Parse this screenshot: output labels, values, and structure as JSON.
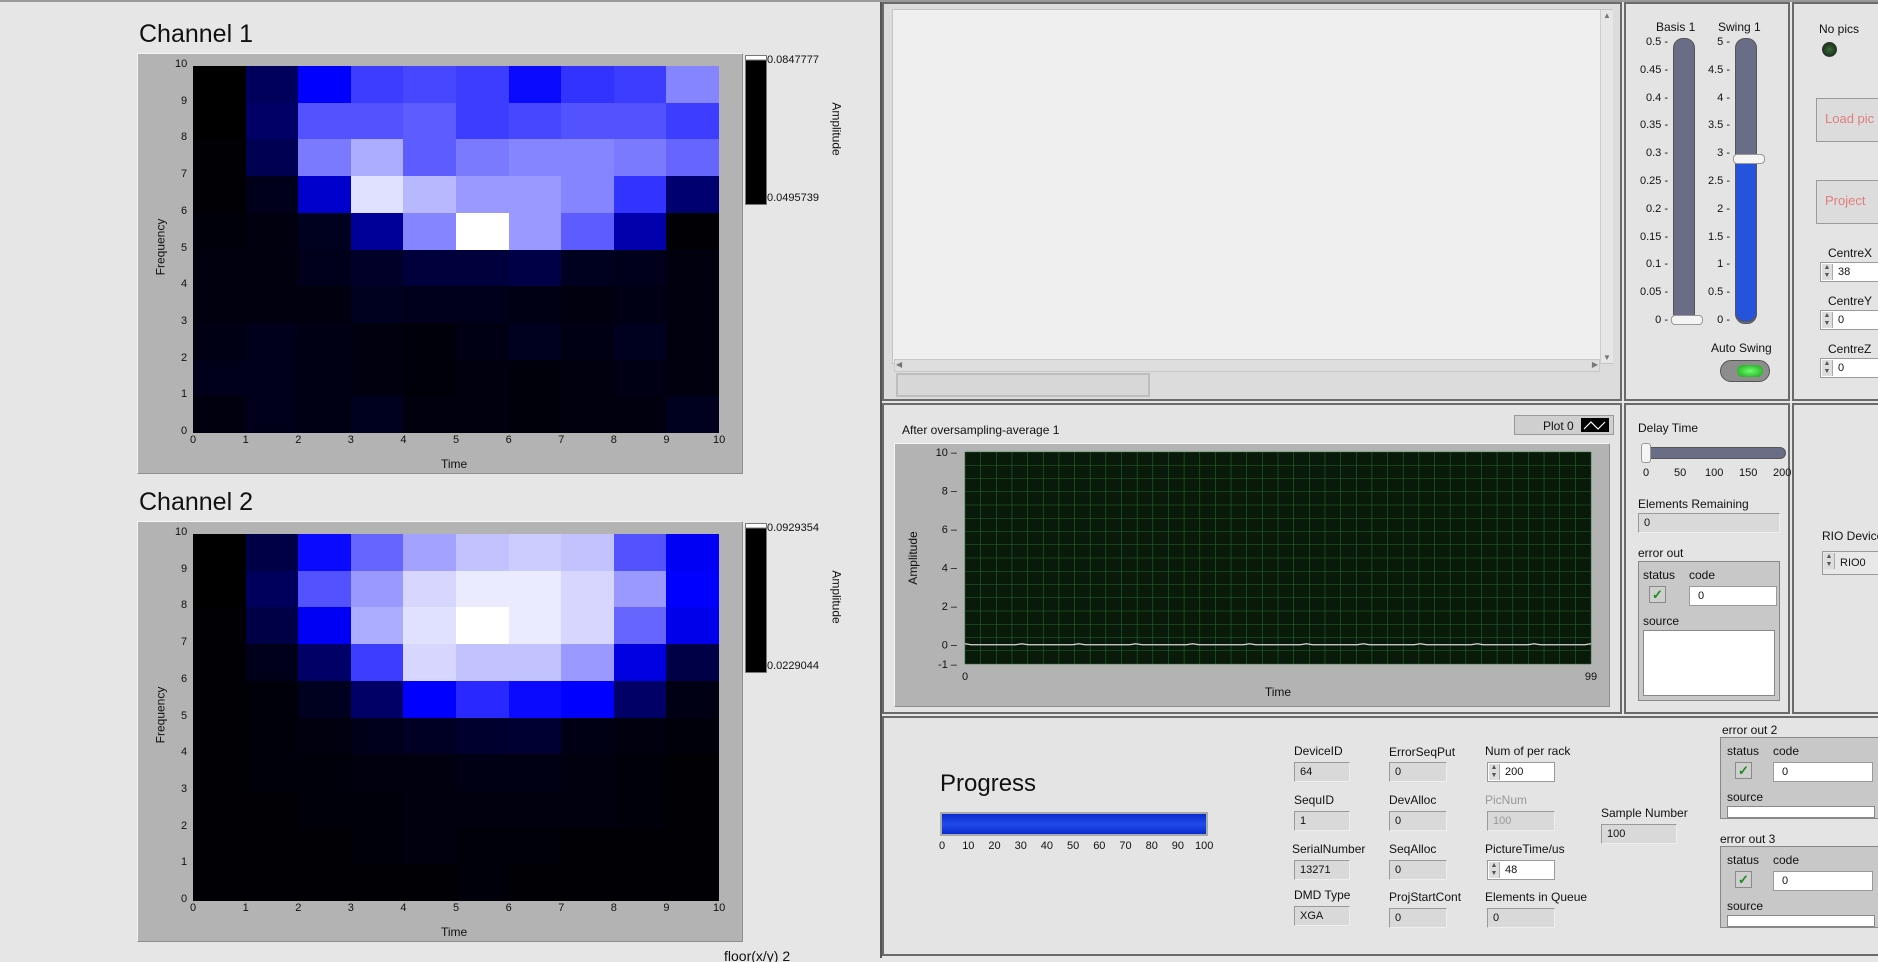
{
  "colors": {
    "accent": "#1a3cdc",
    "panel_bg": "#e6e6e6",
    "led_off": "#1c4a1c",
    "led_on": "#2fd12f",
    "plot_bg": "#0a1a0a",
    "plot_grid": "#1f6a2a",
    "ramp_top": "#ffffff",
    "ramp_bottom": "#000000"
  },
  "channel1": {
    "title": "Channel 1",
    "xlabel": "Time",
    "ylabel": "Frequency",
    "zlabel": "Amplitude",
    "zmax": "0.0847777",
    "zmin": "0.0495739",
    "ticks": [
      "0",
      "1",
      "2",
      "3",
      "4",
      "5",
      "6",
      "7",
      "8",
      "9",
      "10"
    ]
  },
  "channel2": {
    "title": "Channel 2",
    "xlabel": "Time",
    "ylabel": "Frequency",
    "zlabel": "Amplitude",
    "zmax": "0.0929354",
    "zmin": "0.0229044",
    "ticks": [
      "0",
      "1",
      "2",
      "3",
      "4",
      "5",
      "6",
      "7",
      "8",
      "9",
      "10"
    ]
  },
  "footer_text": "floor(x/y) 2",
  "chart_data": [
    {
      "type": "heatmap",
      "title": "Channel 1",
      "xlabel": "Time",
      "ylabel": "Frequency",
      "zlabel": "Amplitude",
      "xlim": [
        0,
        10
      ],
      "ylim": [
        0,
        10
      ],
      "zlim": [
        0.0495739,
        0.0847777
      ],
      "rows_top_to_bottom": [
        [
          0.0,
          0.18,
          0.5,
          0.62,
          0.64,
          0.62,
          0.52,
          0.6,
          0.62,
          0.76
        ],
        [
          0.0,
          0.2,
          0.66,
          0.66,
          0.68,
          0.62,
          0.64,
          0.66,
          0.66,
          0.62
        ],
        [
          0.01,
          0.16,
          0.74,
          0.84,
          0.68,
          0.74,
          0.76,
          0.76,
          0.74,
          0.7
        ],
        [
          0.01,
          0.05,
          0.4,
          0.94,
          0.86,
          0.8,
          0.8,
          0.76,
          0.6,
          0.22
        ],
        [
          0.02,
          0.03,
          0.06,
          0.3,
          0.76,
          1.0,
          0.8,
          0.68,
          0.34,
          0.01
        ],
        [
          0.03,
          0.03,
          0.05,
          0.08,
          0.12,
          0.12,
          0.14,
          0.06,
          0.05,
          0.03
        ],
        [
          0.03,
          0.03,
          0.03,
          0.06,
          0.05,
          0.05,
          0.04,
          0.03,
          0.04,
          0.03
        ],
        [
          0.04,
          0.05,
          0.04,
          0.03,
          0.02,
          0.04,
          0.06,
          0.04,
          0.06,
          0.03
        ],
        [
          0.05,
          0.05,
          0.04,
          0.03,
          0.02,
          0.03,
          0.02,
          0.03,
          0.04,
          0.03
        ],
        [
          0.03,
          0.05,
          0.04,
          0.06,
          0.03,
          0.03,
          0.02,
          0.03,
          0.03,
          0.06
        ]
      ]
    },
    {
      "type": "heatmap",
      "title": "Channel 2",
      "xlabel": "Time",
      "ylabel": "Frequency",
      "zlabel": "Amplitude",
      "xlim": [
        0,
        10
      ],
      "ylim": [
        0,
        10
      ],
      "zlim": [
        0.0229044,
        0.0929354
      ],
      "rows_top_to_bottom": [
        [
          0.0,
          0.14,
          0.52,
          0.7,
          0.82,
          0.88,
          0.9,
          0.88,
          0.66,
          0.48
        ],
        [
          0.0,
          0.18,
          0.66,
          0.8,
          0.92,
          0.96,
          0.96,
          0.92,
          0.8,
          0.5
        ],
        [
          0.01,
          0.14,
          0.48,
          0.84,
          0.94,
          1.0,
          0.96,
          0.92,
          0.7,
          0.46
        ],
        [
          0.01,
          0.05,
          0.2,
          0.62,
          0.92,
          0.88,
          0.88,
          0.8,
          0.44,
          0.14
        ],
        [
          0.01,
          0.02,
          0.06,
          0.2,
          0.5,
          0.58,
          0.52,
          0.5,
          0.2,
          0.04
        ],
        [
          0.01,
          0.02,
          0.03,
          0.05,
          0.07,
          0.09,
          0.1,
          0.04,
          0.03,
          0.02
        ],
        [
          0.01,
          0.02,
          0.02,
          0.03,
          0.03,
          0.04,
          0.04,
          0.03,
          0.02,
          0.01
        ],
        [
          0.01,
          0.01,
          0.02,
          0.02,
          0.03,
          0.03,
          0.03,
          0.03,
          0.02,
          0.01
        ],
        [
          0.01,
          0.01,
          0.01,
          0.02,
          0.03,
          0.02,
          0.02,
          0.01,
          0.01,
          0.01
        ],
        [
          0.01,
          0.01,
          0.01,
          0.01,
          0.01,
          0.02,
          0.01,
          0.01,
          0.01,
          0.01
        ]
      ]
    },
    {
      "type": "line",
      "title": "After oversampling-average 1",
      "xlabel": "Time",
      "ylabel": "Amplitude",
      "xlim": [
        0,
        99
      ],
      "ylim": [
        -1,
        10
      ],
      "series": [
        {
          "name": "Plot 0",
          "values": [
            0,
            0,
            0,
            0,
            0,
            0,
            0,
            0,
            0,
            0,
            0,
            0,
            0,
            0,
            0,
            0,
            0,
            0,
            0,
            0,
            0,
            0,
            0,
            0,
            0,
            0,
            0,
            0,
            0,
            0,
            0,
            0,
            0,
            0,
            0,
            0,
            0,
            0,
            0,
            0,
            0,
            0,
            0,
            0,
            0,
            0,
            0,
            0,
            0,
            0,
            0,
            0,
            0,
            0,
            0,
            0,
            0,
            0,
            0,
            0,
            0,
            0,
            0,
            0,
            0,
            0,
            0,
            0,
            0,
            0,
            0,
            0,
            0,
            0,
            0,
            0,
            0,
            0,
            0,
            0,
            0,
            0,
            0,
            0,
            0,
            0,
            0,
            0,
            0,
            0,
            0,
            0,
            0,
            0,
            0,
            0,
            0,
            0,
            0,
            0
          ]
        }
      ],
      "yticks": [
        "10",
        "8",
        "6",
        "4",
        "2",
        "0",
        "-1"
      ],
      "xticks": [
        "0",
        "99"
      ]
    }
  ],
  "slider1": {
    "label": "Basis 1",
    "ticks": [
      "0.5",
      "0.45",
      "0.4",
      "0.35",
      "0.3",
      "0.25",
      "0.2",
      "0.15",
      "0.1",
      "0.05",
      "0"
    ],
    "value": 0,
    "max": 0.5
  },
  "slider2": {
    "label": "Swing 1",
    "ticks": [
      "5",
      "4.5",
      "4",
      "3.5",
      "3",
      "2.5",
      "2",
      "1.5",
      "1",
      "0.5",
      "0"
    ],
    "value": 2.9,
    "max": 5
  },
  "auto_swing": {
    "label": "Auto Swing"
  },
  "nopics": {
    "label": "No pics"
  },
  "buttons": {
    "load": "Load pic",
    "project": "Project"
  },
  "centre": {
    "x_label": "CentreX",
    "x_value": "38",
    "y_label": "CentreY",
    "y_value": "0",
    "z_label": "CentreZ",
    "z_value": "0"
  },
  "graph": {
    "title": "After oversampling-average 1",
    "legend": "Plot 0",
    "ylabel": "Amplitude",
    "xlabel": "Time"
  },
  "delay": {
    "label": "Delay Time",
    "ticks": [
      "0",
      "50",
      "100",
      "150",
      "200"
    ],
    "value": 0,
    "max": 200
  },
  "elements_remaining": {
    "label": "Elements Remaining",
    "value": "0"
  },
  "error_out": {
    "label": "error out",
    "status": "status",
    "code": "code",
    "code_value": "0",
    "source": "source"
  },
  "rio": {
    "label": "RIO Device",
    "value": "RIO0"
  },
  "progress": {
    "label": "Progress",
    "value": 100,
    "ticks": [
      "0",
      "10",
      "20",
      "30",
      "40",
      "50",
      "60",
      "70",
      "80",
      "90",
      "100"
    ]
  },
  "fields": {
    "device_id": {
      "label": "DeviceID",
      "value": "64"
    },
    "sequ_id": {
      "label": "SequID",
      "value": "1"
    },
    "serial": {
      "label": "SerialNumber",
      "value": "13271"
    },
    "dmd": {
      "label": "DMD Type",
      "value": "XGA"
    },
    "err_seq": {
      "label": "ErrorSeqPut",
      "value": "0"
    },
    "dev_alloc": {
      "label": "DevAlloc",
      "value": "0"
    },
    "seq_alloc": {
      "label": "SeqAlloc",
      "value": "0"
    },
    "proj_start": {
      "label": "ProjStartCont",
      "value": "0"
    },
    "num_rack": {
      "label": "Num of per rack",
      "value": "200"
    },
    "picnum": {
      "label": "PicNum",
      "value": "100"
    },
    "pic_time": {
      "label": "PictureTime/us",
      "value": "48"
    },
    "elements_queue": {
      "label": "Elements in Queue",
      "value": "0"
    },
    "sample_number": {
      "label": "Sample Number",
      "value": "100"
    }
  },
  "error_out2": {
    "label": "error out 2",
    "status": "status",
    "code": "code",
    "code_value": "0",
    "source": "source"
  },
  "error_out3": {
    "label": "error out 3",
    "status": "status",
    "code": "code",
    "code_value": "0",
    "source": "source"
  }
}
